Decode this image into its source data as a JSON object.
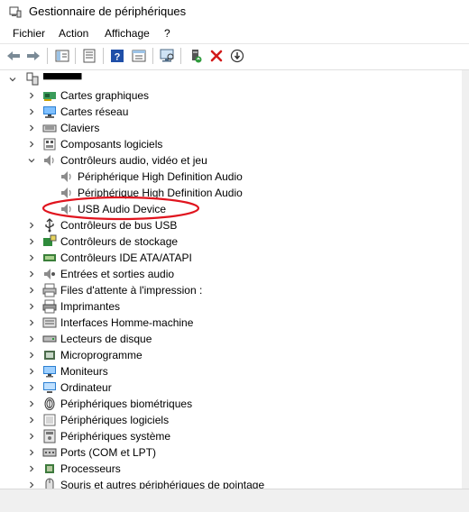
{
  "window": {
    "title": "Gestionnaire de périphériques"
  },
  "menu": [
    {
      "label": "Fichier"
    },
    {
      "label": "Action"
    },
    {
      "label": "Affichage"
    },
    {
      "label": "?"
    }
  ],
  "toolbar": {
    "buttons": [
      "back-arrow-icon",
      "forward-arrow-icon",
      "show-hide-console-tree-icon",
      "properties-icon",
      "help-icon",
      "action-pane-icon",
      "scan-hardware-icon",
      "update-driver-icon",
      "uninstall-device-icon",
      "disable-device-icon"
    ]
  },
  "tree": {
    "root": {
      "label": "▀▀▀▀▀"
    },
    "categories": [
      {
        "label": "Cartes graphiques",
        "icon": "display-adapter-icon"
      },
      {
        "label": "Cartes réseau",
        "icon": "network-adapter-icon"
      },
      {
        "label": "Claviers",
        "icon": "keyboard-icon"
      },
      {
        "label": "Composants logiciels",
        "icon": "software-component-icon"
      },
      {
        "label": "Contrôleurs audio, vidéo et jeu",
        "icon": "speaker-icon",
        "expanded": true,
        "children": [
          {
            "label": "Périphérique High Definition Audio",
            "icon": "speaker-icon"
          },
          {
            "label": "Périphérique High Definition Audio",
            "icon": "speaker-icon"
          },
          {
            "label": "USB Audio Device",
            "icon": "speaker-icon",
            "selected": true
          }
        ]
      },
      {
        "label": "Contrôleurs de bus USB",
        "icon": "usb-controller-icon"
      },
      {
        "label": "Contrôleurs de stockage",
        "icon": "storage-controller-icon"
      },
      {
        "label": "Contrôleurs IDE ATA/ATAPI",
        "icon": "ide-controller-icon"
      },
      {
        "label": "Entrées et sorties audio",
        "icon": "audio-io-icon"
      },
      {
        "label": "Files d'attente à l'impression :",
        "icon": "print-queue-icon"
      },
      {
        "label": "Imprimantes",
        "icon": "printer-icon"
      },
      {
        "label": "Interfaces Homme-machine",
        "icon": "hid-icon"
      },
      {
        "label": "Lecteurs de disque",
        "icon": "disk-drive-icon"
      },
      {
        "label": "Microprogramme",
        "icon": "firmware-icon"
      },
      {
        "label": "Moniteurs",
        "icon": "monitor-icon"
      },
      {
        "label": "Ordinateur",
        "icon": "computer-icon"
      },
      {
        "label": "Périphériques biométriques",
        "icon": "biometric-icon"
      },
      {
        "label": "Périphériques logiciels",
        "icon": "software-device-icon"
      },
      {
        "label": "Périphériques système",
        "icon": "system-device-icon"
      },
      {
        "label": "Ports (COM et LPT)",
        "icon": "port-icon"
      },
      {
        "label": "Processeurs",
        "icon": "processor-icon"
      },
      {
        "label": "Souris et autres périphériques de pointage",
        "icon": "mouse-icon"
      }
    ]
  },
  "annotation": {
    "color": "#e0141e"
  }
}
